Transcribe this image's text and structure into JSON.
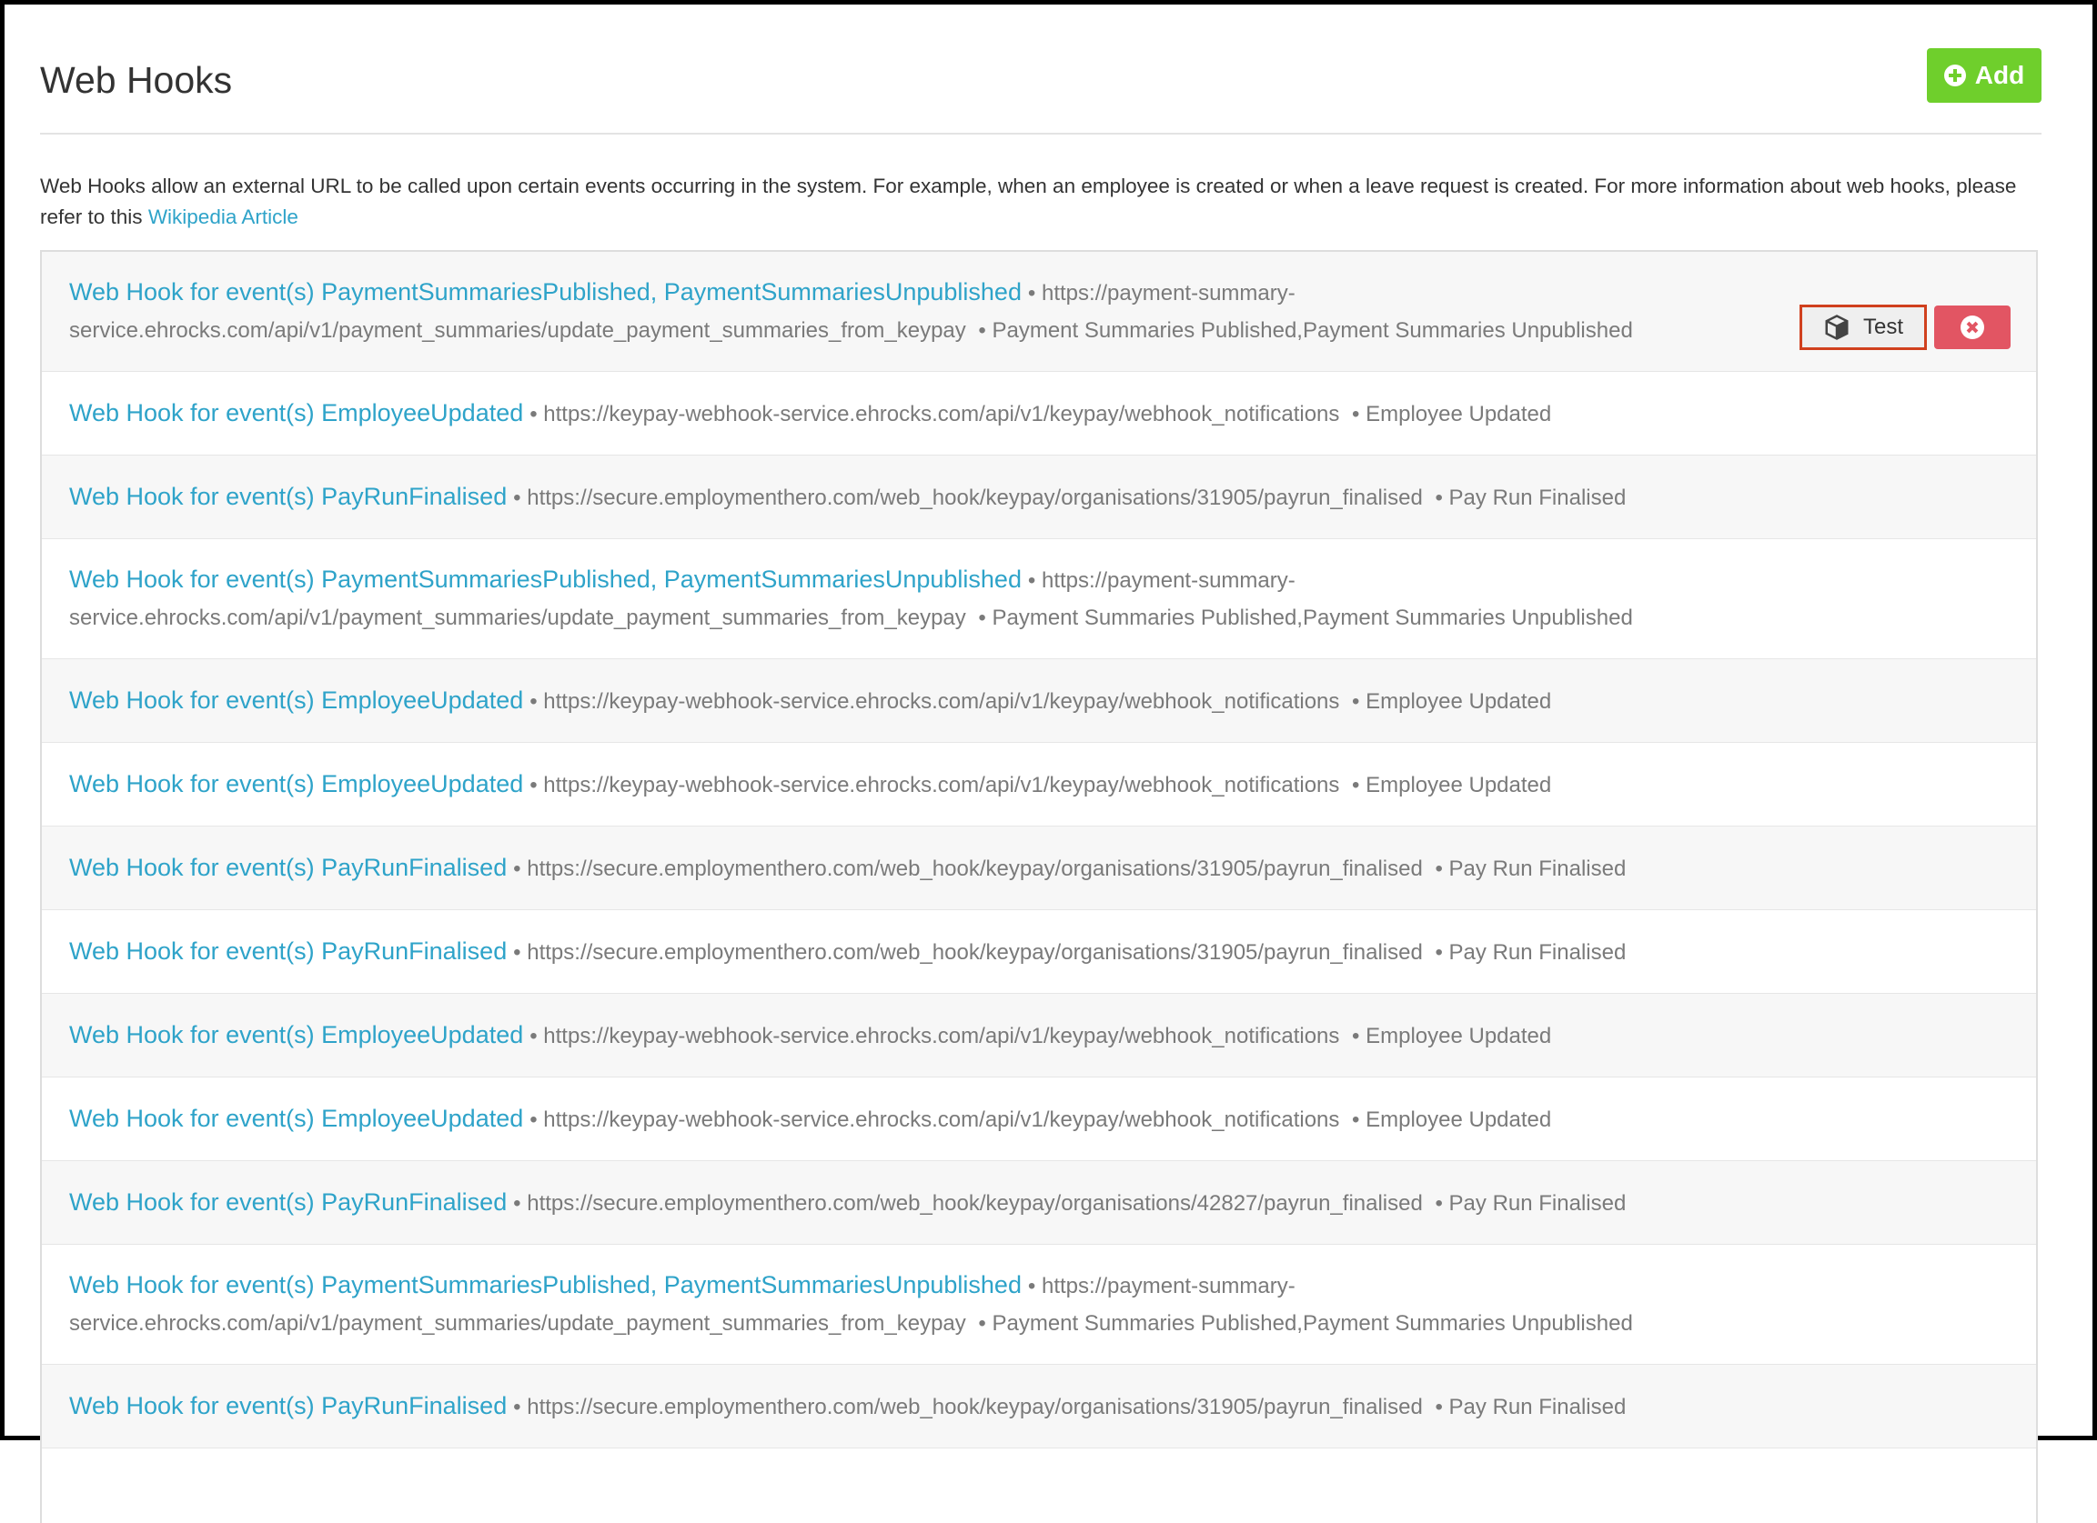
{
  "header": {
    "title": "Web Hooks",
    "add_label": "Add"
  },
  "intro": {
    "text": "Web Hooks allow an external URL to be called upon certain events occurring in the system. For example, when an employee is created or when a leave request is created. For more information about web hooks, please refer to this",
    "link_label": "Wikipedia Article"
  },
  "actions": {
    "test_label": "Test"
  },
  "colors": {
    "add_button": "#6fcf2c",
    "link": "#2ea3c9",
    "delete_button": "#e25563",
    "test_highlight": "#d0401e"
  },
  "webhooks": [
    {
      "link": "Web Hook for event(s) PaymentSummariesPublished, PaymentSummariesUnpublished",
      "url": "https://payment-summary-service.ehrocks.com/api/v1/payment_summaries/update_payment_summaries_from_keypay",
      "events": "Payment Summaries Published,Payment Summaries Unpublished"
    },
    {
      "link": "Web Hook for event(s) EmployeeUpdated",
      "url": "https://keypay-webhook-service.ehrocks.com/api/v1/keypay/webhook_notifications",
      "events": "Employee Updated"
    },
    {
      "link": "Web Hook for event(s) PayRunFinalised",
      "url": "https://secure.employmenthero.com/web_hook/keypay/organisations/31905/payrun_finalised",
      "events": "Pay Run Finalised"
    },
    {
      "link": "Web Hook for event(s) PaymentSummariesPublished, PaymentSummariesUnpublished",
      "url": "https://payment-summary-service.ehrocks.com/api/v1/payment_summaries/update_payment_summaries_from_keypay",
      "events": "Payment Summaries Published,Payment Summaries Unpublished"
    },
    {
      "link": "Web Hook for event(s) EmployeeUpdated",
      "url": "https://keypay-webhook-service.ehrocks.com/api/v1/keypay/webhook_notifications",
      "events": "Employee Updated"
    },
    {
      "link": "Web Hook for event(s) EmployeeUpdated",
      "url": "https://keypay-webhook-service.ehrocks.com/api/v1/keypay/webhook_notifications",
      "events": "Employee Updated"
    },
    {
      "link": "Web Hook for event(s) PayRunFinalised",
      "url": "https://secure.employmenthero.com/web_hook/keypay/organisations/31905/payrun_finalised",
      "events": "Pay Run Finalised"
    },
    {
      "link": "Web Hook for event(s) PayRunFinalised",
      "url": "https://secure.employmenthero.com/web_hook/keypay/organisations/31905/payrun_finalised",
      "events": "Pay Run Finalised"
    },
    {
      "link": "Web Hook for event(s) EmployeeUpdated",
      "url": "https://keypay-webhook-service.ehrocks.com/api/v1/keypay/webhook_notifications",
      "events": "Employee Updated"
    },
    {
      "link": "Web Hook for event(s) EmployeeUpdated",
      "url": "https://keypay-webhook-service.ehrocks.com/api/v1/keypay/webhook_notifications",
      "events": "Employee Updated"
    },
    {
      "link": "Web Hook for event(s) PayRunFinalised",
      "url": "https://secure.employmenthero.com/web_hook/keypay/organisations/42827/payrun_finalised",
      "events": "Pay Run Finalised"
    },
    {
      "link": "Web Hook for event(s) PaymentSummariesPublished, PaymentSummariesUnpublished",
      "url": "https://payment-summary-service.ehrocks.com/api/v1/payment_summaries/update_payment_summaries_from_keypay",
      "events": "Payment Summaries Published,Payment Summaries Unpublished"
    },
    {
      "link": "Web Hook for event(s) PayRunFinalised",
      "url": "https://secure.employmenthero.com/web_hook/keypay/organisations/31905/payrun_finalised",
      "events": "Pay Run Finalised"
    }
  ]
}
